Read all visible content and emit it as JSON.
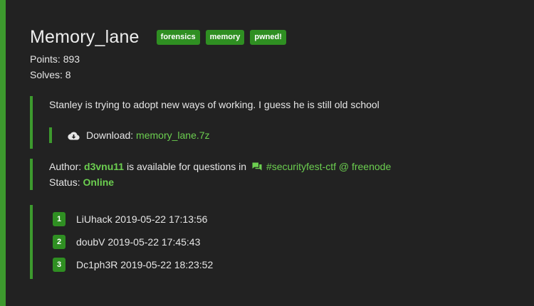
{
  "challenge": {
    "title": "Memory_lane",
    "tags": [
      "forensics",
      "memory",
      "pwned!"
    ],
    "points_label": "Points: 893",
    "solves_label": "Solves: 8",
    "description": "Stanley is trying to adopt new ways of working. I guess he is still old school",
    "download_label": "Download:",
    "download_file": "memory_lane.7z",
    "download_icon": "cloud-download-icon"
  },
  "author": {
    "label": "Author:",
    "name": "d3vnu11",
    "middle_text": "is available for questions in",
    "chat_icon": "chat-icon",
    "channel": "#securityfest-ctf @ freenode",
    "status_label": "Status:",
    "status_value": "Online"
  },
  "solves": [
    {
      "rank": "1",
      "text": "LiUhack 2019-05-22 17:13:56"
    },
    {
      "rank": "2",
      "text": "doubV 2019-05-22 17:45:43"
    },
    {
      "rank": "3",
      "text": "Dc1ph3R 2019-05-22 18:23:52"
    }
  ],
  "colors": {
    "background": "#222222",
    "accent": "#3d9a2e",
    "link": "#6ccf50",
    "badge": "#2f8f22"
  }
}
